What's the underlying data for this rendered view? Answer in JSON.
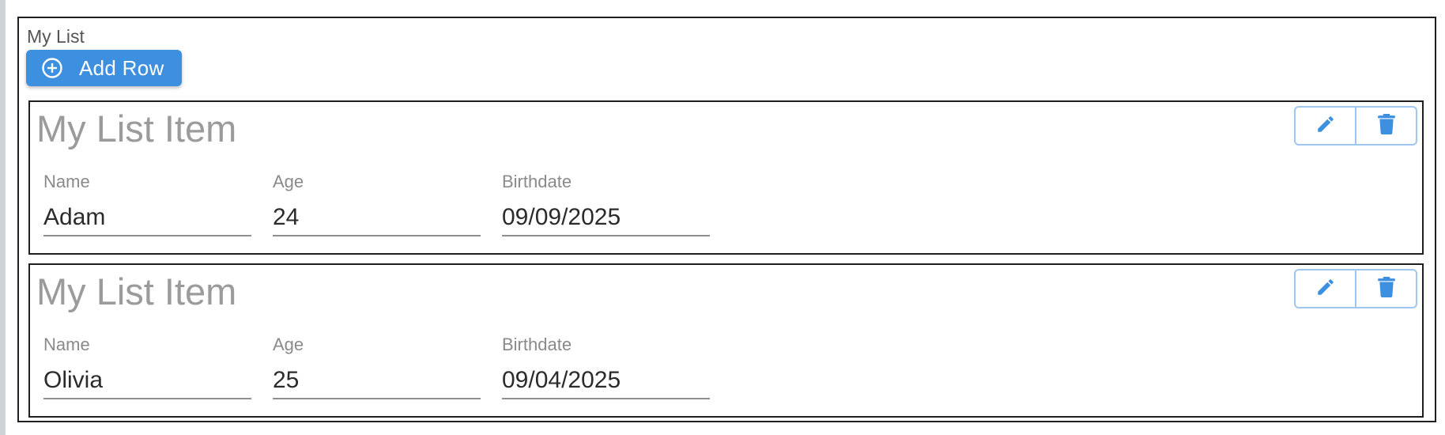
{
  "list": {
    "label": "My List",
    "add_row_label": "Add Row",
    "add_icon": "plus-circle-icon",
    "accent_color": "#3d8fe0",
    "items": [
      {
        "title": "My List Item",
        "fields": {
          "name_label": "Name",
          "name_value": "Adam",
          "age_label": "Age",
          "age_value": "24",
          "birthdate_label": "Birthdate",
          "birthdate_value": "09/09/2025"
        },
        "actions": [
          "pencil-icon",
          "trash-icon"
        ]
      },
      {
        "title": "My List Item",
        "fields": {
          "name_label": "Name",
          "name_value": "Olivia",
          "age_label": "Age",
          "age_value": "25",
          "birthdate_label": "Birthdate",
          "birthdate_value": "09/04/2025"
        },
        "actions": [
          "pencil-icon",
          "trash-icon"
        ]
      }
    ]
  }
}
